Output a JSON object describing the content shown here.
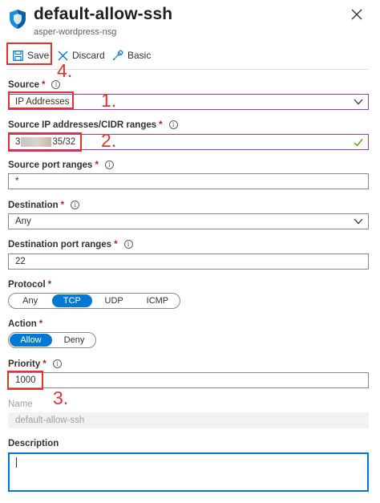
{
  "header": {
    "title": "default-allow-ssh",
    "subtitle": "asper-wordpress-nsg",
    "icon": "shield-icon",
    "close_icon": "close-icon"
  },
  "toolbar": {
    "save_label": "Save",
    "discard_label": "Discard",
    "basic_label": "Basic"
  },
  "form": {
    "source": {
      "label": "Source",
      "required": "*",
      "value": "IP Addresses"
    },
    "source_ip": {
      "label": "Source IP addresses/CIDR ranges",
      "required": "*",
      "value_prefix": "3",
      "value_suffix": "35/32"
    },
    "source_port": {
      "label": "Source port ranges",
      "required": "*",
      "value": "*"
    },
    "destination": {
      "label": "Destination",
      "required": "*",
      "value": "Any"
    },
    "destination_port": {
      "label": "Destination port ranges",
      "required": "*",
      "value": "22"
    },
    "protocol": {
      "label": "Protocol",
      "required": "*",
      "options": [
        "Any",
        "TCP",
        "UDP",
        "ICMP"
      ],
      "selected": "TCP"
    },
    "action": {
      "label": "Action",
      "required": "*",
      "options": [
        "Allow",
        "Deny"
      ],
      "selected": "Allow"
    },
    "priority": {
      "label": "Priority",
      "required": "*",
      "value": "1000"
    },
    "name": {
      "label": "Name",
      "value": "default-allow-ssh"
    },
    "description": {
      "label": "Description",
      "value": ""
    }
  },
  "annotations": {
    "step1": "1.",
    "step2": "2.",
    "step3": "3.",
    "step4": "4."
  },
  "colors": {
    "accent": "#0078d4",
    "focus_border": "#9c39b3",
    "annotation": "#e8302f",
    "valid_check": "#57a300"
  }
}
